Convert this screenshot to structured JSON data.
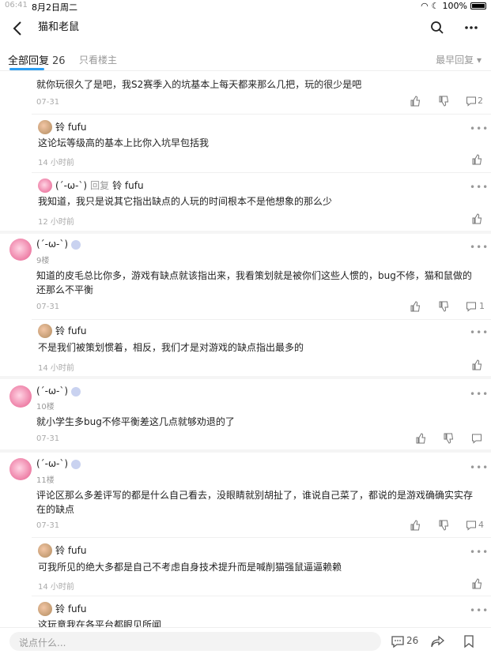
{
  "status": {
    "time": "06:41",
    "date": "8月2日周二",
    "battery": "100%"
  },
  "nav": {
    "title": "猫和老鼠"
  },
  "tabs": {
    "all": "全部回复",
    "all_count": "26",
    "host_only": "只看楼主",
    "sort": "最早回复 ▾"
  },
  "comments": [
    {
      "text": "就你玩很久了是吧，我S2赛季入的坑基本上每天都来那么几把，玩的很少是吧",
      "time": "07-31",
      "reply_count": "2",
      "replies": [
        {
          "name": "铃 fufu",
          "text": "这论坛等级高的基本上比你入坑早包括我",
          "time": "14 小时前"
        },
        {
          "name": "(´-ω-`)",
          "reply_label": "回复",
          "reply_to": "铃 fufu",
          "text": "我知道，我只是说其它指出缺点的人玩的时间根本不是他想象的那么少",
          "time": "12 小时前"
        }
      ]
    },
    {
      "name": "(´-ω-`)",
      "floor": "9楼",
      "text": "知道的皮毛总比你多，游戏有缺点就该指出来，我看策划就是被你们这些人惯的，bug不修，猫和鼠做的还那么不平衡",
      "time": "07-31",
      "reply_count": "1",
      "replies": [
        {
          "name": "铃 fufu",
          "text": "不是我们被策划惯着，相反，我们才是对游戏的缺点指出最多的",
          "time": "14 小时前"
        }
      ]
    },
    {
      "name": "(´-ω-`)",
      "floor": "10楼",
      "text": "就小学生多bug不修平衡差这几点就够劝退的了",
      "time": "07-31"
    },
    {
      "name": "(´-ω-`)",
      "floor": "11楼",
      "text": "评论区那么多差评写的都是什么自己看去，没眼睛就别胡扯了，谁说自己菜了，都说的是游戏确确实实存在的缺点",
      "time": "07-31",
      "reply_count": "4",
      "replies": [
        {
          "name": "铃 fufu",
          "text": "可我所见的绝大多都是自己不考虑自身技术提升而是喊削猫强鼠逼逼赖赖",
          "time": "14 小时前"
        },
        {
          "name": "铃 fufu",
          "text": "这玩意我在各平台都眼见所闻",
          "time": ""
        }
      ]
    }
  ],
  "bottom": {
    "placeholder": "说点什么...",
    "comment_count": "26"
  }
}
